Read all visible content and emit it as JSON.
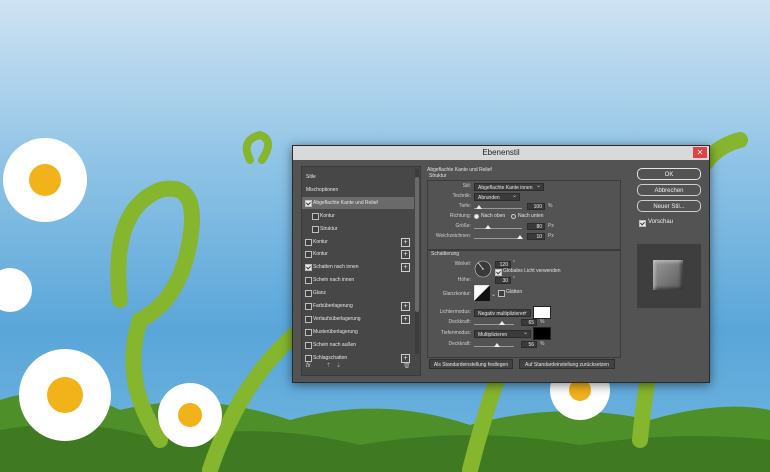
{
  "dialog": {
    "title": "Ebenenstil",
    "close_glyph": "✕"
  },
  "styles_panel": {
    "items": [
      {
        "label": "Stile",
        "checkbox": false,
        "checked": false,
        "indent": false,
        "plus": false,
        "selected": false
      },
      {
        "label": "Mischoptionen",
        "checkbox": false,
        "checked": false,
        "indent": false,
        "plus": false,
        "selected": false
      },
      {
        "label": "Abgeflachte Kante und Relief",
        "checkbox": true,
        "checked": true,
        "indent": false,
        "plus": false,
        "selected": true
      },
      {
        "label": "Kontur",
        "checkbox": true,
        "checked": false,
        "indent": true,
        "plus": false,
        "selected": false
      },
      {
        "label": "Struktur",
        "checkbox": true,
        "checked": false,
        "indent": true,
        "plus": false,
        "selected": false
      },
      {
        "label": "Kontur",
        "checkbox": true,
        "checked": false,
        "indent": false,
        "plus": true,
        "selected": false
      },
      {
        "label": "Kontur",
        "checkbox": true,
        "checked": false,
        "indent": false,
        "plus": true,
        "selected": false
      },
      {
        "label": "Schatten nach innen",
        "checkbox": true,
        "checked": true,
        "indent": false,
        "plus": true,
        "selected": false
      },
      {
        "label": "Schein nach innen",
        "checkbox": true,
        "checked": false,
        "indent": false,
        "plus": false,
        "selected": false
      },
      {
        "label": "Glanz",
        "checkbox": true,
        "checked": false,
        "indent": false,
        "plus": false,
        "selected": false
      },
      {
        "label": "Farbüberlagerung",
        "checkbox": true,
        "checked": false,
        "indent": false,
        "plus": true,
        "selected": false
      },
      {
        "label": "Verlaufsüberlagerung",
        "checkbox": true,
        "checked": false,
        "indent": false,
        "plus": true,
        "selected": false
      },
      {
        "label": "Musterüberlagerung",
        "checkbox": true,
        "checked": false,
        "indent": false,
        "plus": false,
        "selected": false
      },
      {
        "label": "Schein nach außen",
        "checkbox": true,
        "checked": false,
        "indent": false,
        "plus": false,
        "selected": false
      },
      {
        "label": "Schlagschatten",
        "checkbox": true,
        "checked": false,
        "indent": false,
        "plus": true,
        "selected": false
      }
    ],
    "fx_label": "fx"
  },
  "bevel": {
    "section_title": "Abgeflachte Kante und Relief",
    "structure_title": "Struktur",
    "style_label": "Stil:",
    "style_value": "Abgeflachte Kante innen",
    "technique_label": "Technik:",
    "technique_value": "Abrunden",
    "depth_label": "Tiefe:",
    "depth_value": "100",
    "depth_unit": "%",
    "direction_label": "Richtung:",
    "direction_up": "Nach oben",
    "direction_down": "Nach unten",
    "size_label": "Größe:",
    "size_value": "80",
    "size_unit": "Px",
    "soften_label": "Weichzeichnen:",
    "soften_value": "10",
    "soften_unit": "Px"
  },
  "shading": {
    "title": "Schattierung",
    "angle_label": "Winkel:",
    "angle_value": "120",
    "angle_unit": "°",
    "global_light_label": "Globales Licht verwenden",
    "altitude_label": "Höhe:",
    "altitude_value": "30",
    "altitude_unit": "°",
    "gloss_label": "Glanzkontur:",
    "antialias_label": "Glätten",
    "highlight_label": "Lichtermodus:",
    "highlight_value": "Negativ multiplizieren",
    "highlight_color": "#ffffff",
    "opacity1_label": "Deckkraft:",
    "opacity1_value": "65",
    "shadow_label": "Tiefenmodus:",
    "shadow_value": "Multiplizieren",
    "shadow_color": "#000000",
    "opacity2_label": "Deckkraft:",
    "opacity2_value": "56",
    "pct": "%"
  },
  "buttons": {
    "make_default": "Als Standardeinstellung festlegen",
    "reset_default": "Auf Standardeinstellung zurücksetzen"
  },
  "right_panel": {
    "ok": "OK",
    "cancel": "Abbrechen",
    "new_style": "Neuer Stil...",
    "preview_label": "Vorschau"
  },
  "colors": {
    "dialog_bg": "#535353",
    "close_red": "#e04343",
    "sky_blue": "#5aa6d9",
    "grass_green": "#6fae2e"
  }
}
